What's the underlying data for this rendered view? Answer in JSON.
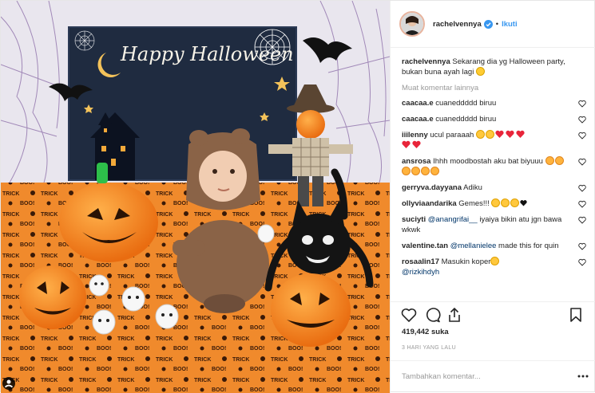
{
  "post": {
    "username": "rachelvennya",
    "separator": "•",
    "follow_label": "Ikuti",
    "caption": {
      "username": "rachelvennya",
      "text": "Sekarang dia yg Halloween party, bukan buna ayah lagi"
    },
    "load_more_label": "Muat komentar lainnya",
    "comments": [
      {
        "username": "caacaa.e",
        "text": "cuaneddddd biruu"
      },
      {
        "username": "caacaa.e",
        "text": "cuaneddddd biruu"
      },
      {
        "username": "iiilenny",
        "text": "ucul paraaah"
      },
      {
        "username": "ansrosa",
        "text": "Ihhh moodbostah aku bat biyuuu"
      },
      {
        "username": "gerryva.dayyana",
        "text": "Adiku"
      },
      {
        "username": "ollyviaandarika",
        "text": "Gemes!!!"
      },
      {
        "username": "suciyti",
        "mention": "@anangrifai__",
        "text": " iyaiya bikin atu jgn bawa wkwk"
      },
      {
        "username": "valentine.tan",
        "mention": "@mellanielee",
        "text": " made this for quin"
      },
      {
        "username": "rosaalin17",
        "text": "Masukin koper",
        "mention2": "@rizkihdyh"
      }
    ],
    "likes": "419,442 suka",
    "time_ago": "3 HARI YANG LALU",
    "add_comment_placeholder": "Tambahkan komentar..."
  },
  "photo": {
    "banner_text": "Happy Halloween"
  },
  "colors": {
    "accent": "#3897f0",
    "orange": "#f4882a",
    "banner": "#1f2b40",
    "heart": "#e8253a"
  },
  "icons": [
    "verified-icon",
    "heart-icon",
    "comment-icon",
    "share-icon",
    "bookmark-icon",
    "more-icon",
    "user-tag-icon"
  ]
}
